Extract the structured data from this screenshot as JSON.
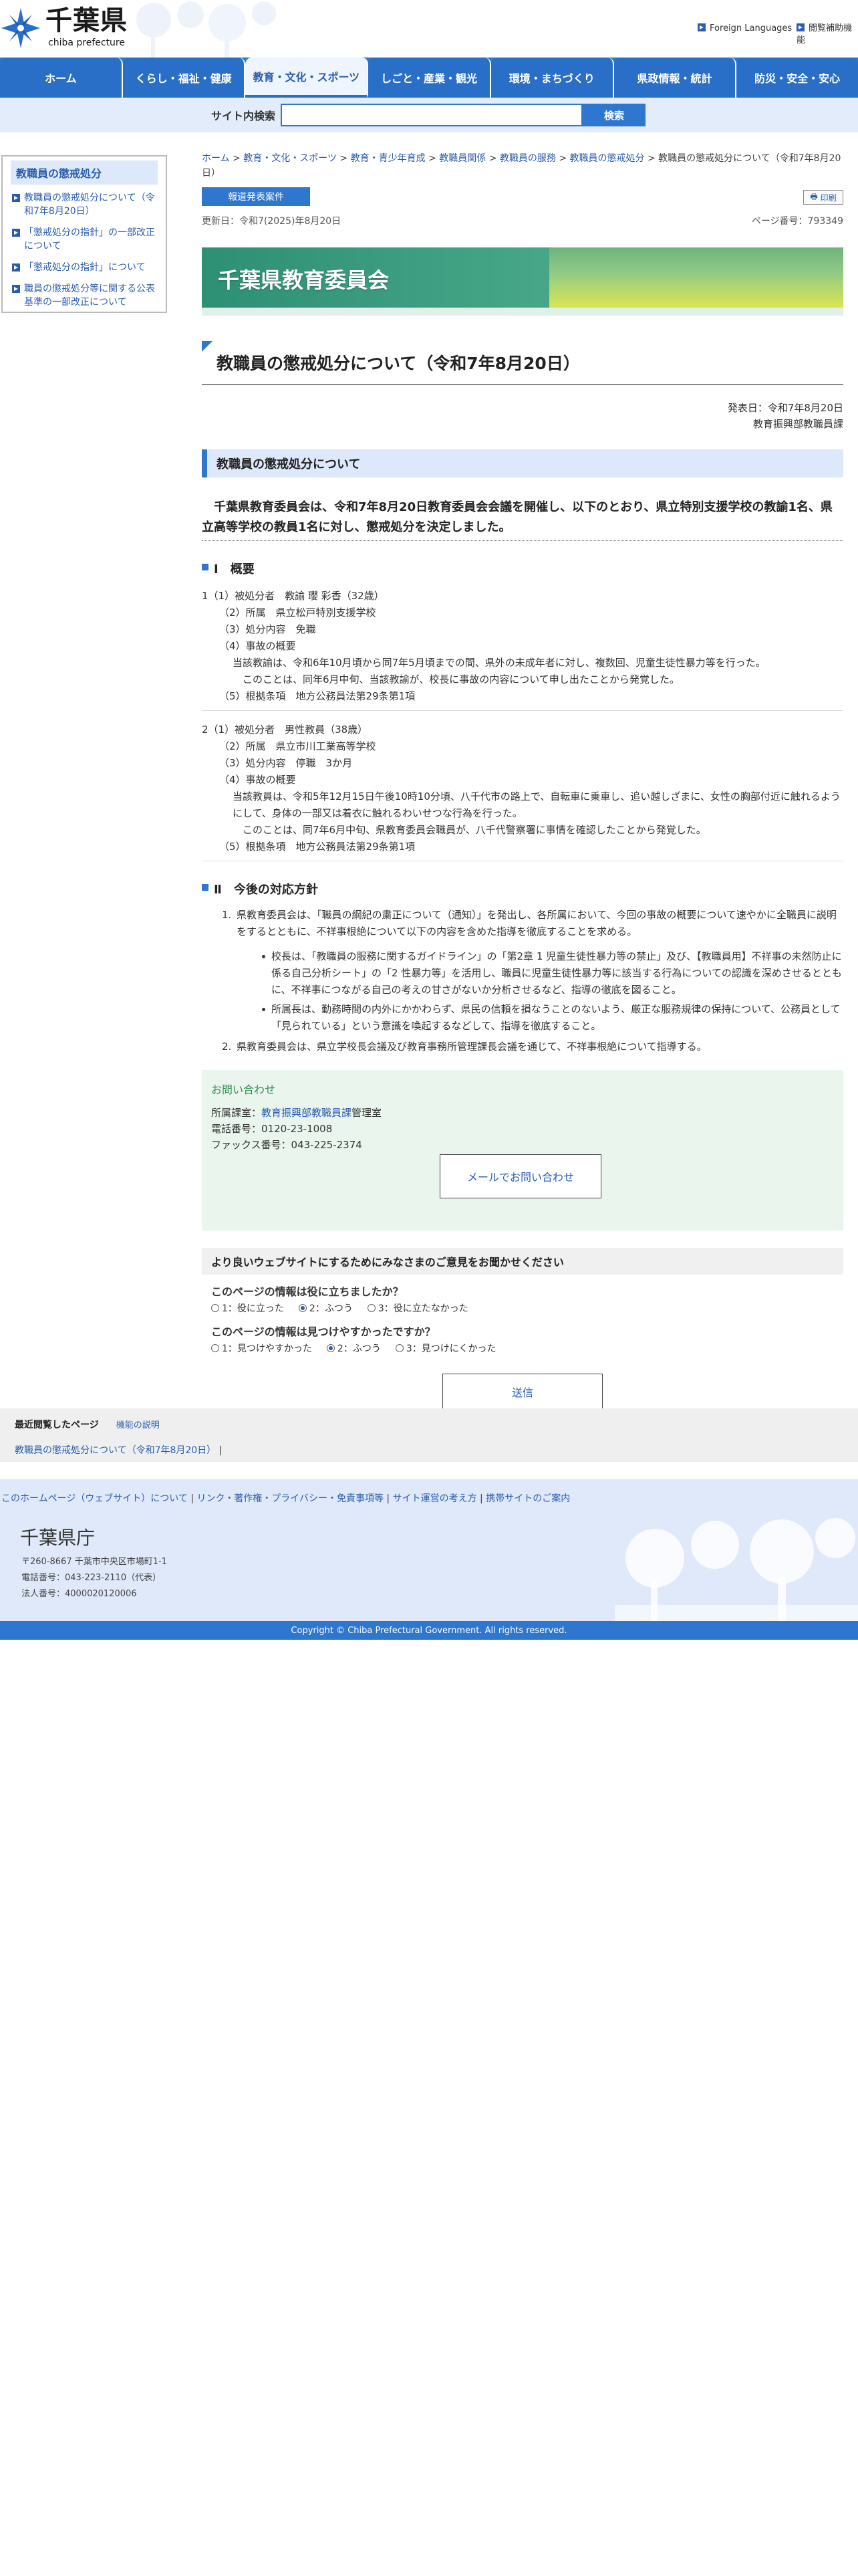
{
  "header": {
    "logo_jp": "千葉県",
    "logo_en": "chiba prefecture",
    "links": [
      "Foreign Languages",
      "閲覧補助機能"
    ]
  },
  "nav": [
    "ホーム",
    "くらし・福祉・健康",
    "教育・文化・スポーツ",
    "しごと・産業・観光",
    "環境・まちづくり",
    "県政情報・統計",
    "防災・安全・安心"
  ],
  "search": {
    "label": "サイト内検索",
    "button": "検索",
    "placeholder": ""
  },
  "side": {
    "title": "教職員の懲戒処分",
    "items": [
      "教職員の懲戒処分について（令和7年8月20日）",
      "「懲戒処分の指針」の一部改正について",
      "「懲戒処分の指針」について",
      "職員の懲戒処分等に関する公表基準の一部改正について"
    ]
  },
  "breadcrumb": {
    "links": [
      "ホーム",
      "教育・文化・スポーツ",
      "教育・青少年育成",
      "教職員関係",
      "教職員の服務",
      "教職員の懲戒処分"
    ],
    "sep": ">",
    "current": "教職員の懲戒処分について（令和7年8月20日）"
  },
  "tag": "報道発表案件",
  "print": "印刷",
  "updated": "更新日：令和7(2025)年8月20日",
  "page_no": "ページ番号：793349",
  "banner": "千葉県教育委員会",
  "title": "教職員の懲戒処分について（令和7年8月20日）",
  "dates": [
    "発表日：令和7年8月20日",
    "教育振興部教職員課"
  ],
  "section": "教職員の懲戒処分について",
  "lead": "千葉県教育委員会は、令和7年8月20日教育委員会会議を開催し、以下のとおり、県立特別支援学校の教諭1名、県立高等学校の教員1名に対し、懲戒処分を決定しました。",
  "h_outline": "Ⅰ　概要",
  "case1": [
    "1（1）被処分者　教諭 瓔 彩香（32歳）",
    "（2）所属　県立松戸特別支援学校",
    "（3）処分内容　免職",
    "（4）事故の概要",
    "当該教諭は、令和6年10月頃から同7年5月頃までの間、県外の未成年者に対し、複数回、児童生徒性暴力等を行った。",
    "このことは、同年6月中旬、当該教諭が、校長に事故の内容について申し出たことから発覚した。",
    "（5）根拠条項　地方公務員法第29条第1項"
  ],
  "case2": [
    "2（1）被処分者　男性教員（38歳）",
    "（2）所属　県立市川工業高等学校",
    "（3）処分内容　停職　3か月",
    "（4）事故の概要",
    "当該教員は、令和5年12月15日午後10時10分頃、八千代市の路上で、自転車に乗車し、追い越しざまに、女性の胸部付近に触れるようにして、身体の一部又は着衣に触れるわいせつな行為を行った。",
    "このことは、同7年6月中旬、県教育委員会職員が、八千代警察署に事情を確認したことから発覚した。",
    "（5）根拠条項　地方公務員法第29条第1項"
  ],
  "h_future": "Ⅱ　今後の対応方針",
  "future": {
    "item1": "県教育委員会は、「職員の綱紀の粛正について（通知）」を発出し、各所属において、今回の事故の概要について速やかに全職員に説明をするとともに、不祥事根絶について以下の内容を含めた指導を徹底することを求める。",
    "bullets": [
      "校長は、「教職員の服務に関するガイドライン」の「第2章 1 児童生徒性暴力等の禁止」及び、【教職員用】不祥事の未然防止に係る自己分析シート」の「2 性暴力等」を活用し、職員に児童生徒性暴力等に該当する行為についての認識を深めさせるとともに、不祥事につながる自己の考えの甘さがないか分析させるなど、指導の徹底を図ること。",
      "所属長は、勤務時間の内外にかかわらず、県民の信頼を損なうことのないよう、厳正な服務規律の保持について、公務員として「見られている」という意識を喚起するなどして、指導を徹底すること。"
    ],
    "item2": "県教育委員会は、県立学校長会議及び教育事務所管理課長会議を通じて、不祥事根絶について指導する。"
  },
  "contact": {
    "title": "お問い合わせ",
    "dept_prefix": "所属課室：",
    "dept_link": "教育振興部教職員課",
    "dept_suffix": "管理室",
    "tel": "電話番号：0120-23-1008",
    "fax": "ファックス番号：043-225-2374",
    "mail": "メールでお問い合わせ"
  },
  "survey": {
    "title": "より良いウェブサイトにするためにみなさまのご意見をお聞かせください",
    "q1": "このページの情報は役に立ちましたか？",
    "q1_opts": [
      "1：役に立った",
      "2：ふつう",
      "3：役に立たなかった"
    ],
    "q2": "このページの情報は見つけやすかったですか？",
    "q2_opts": [
      "1：見つけやすかった",
      "2：ふつう",
      "3：見つけにくかった"
    ],
    "submit": "送信"
  },
  "recent": {
    "title": "最近閲覧したページ",
    "help": "機能の説明",
    "link": "教職員の懲戒処分について（令和7年8月20日）"
  },
  "footer": {
    "links": [
      "このホームページ（ウェブサイト）について",
      "リンク・著作権・プライバシー・免責事項等",
      "サイト運営の考え方",
      "携帯サイトのご案内"
    ],
    "org": "千葉県庁",
    "address": [
      "〒260-8667 千葉市中央区市場町1-1",
      "電話番号：043-223-2110（代表）",
      "法人番号：4000020120006"
    ],
    "copyright": "Copyright © Chiba Prefectural Government. All rights reserved."
  }
}
